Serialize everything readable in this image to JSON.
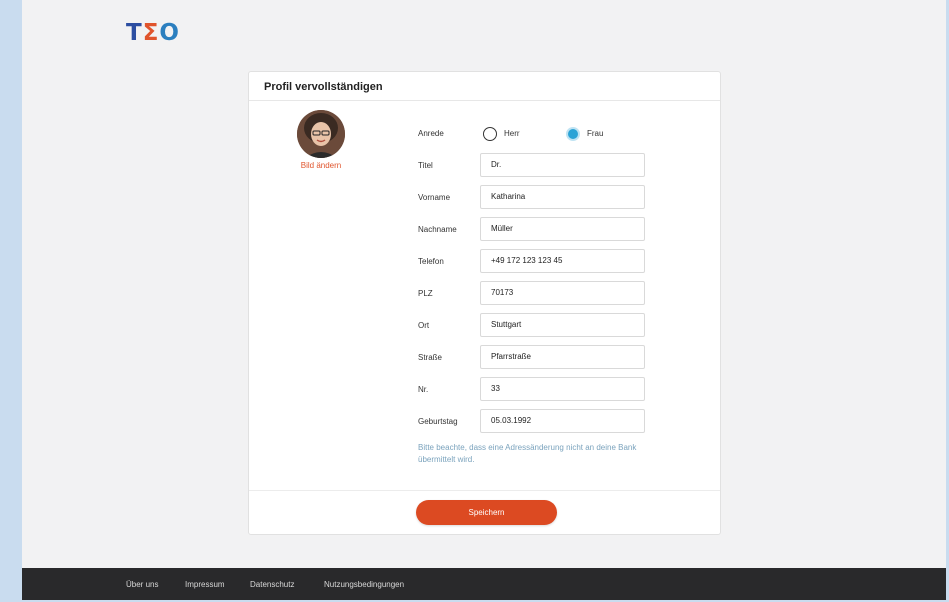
{
  "logo": {
    "part1": "T",
    "part2": "Σ",
    "part3": "O"
  },
  "card": {
    "title": "Profil vervollständigen"
  },
  "profile": {
    "change_photo": "Bild ändern"
  },
  "form": {
    "salutation": {
      "label": "Anrede",
      "options": [
        "Herr",
        "Frau"
      ],
      "selected": "Frau"
    },
    "title": {
      "label": "Titel",
      "value": "Dr."
    },
    "first_name": {
      "label": "Vorname",
      "value": "Katharina"
    },
    "last_name": {
      "label": "Nachname",
      "value": "Müller"
    },
    "phone": {
      "label": "Telefon",
      "value": "+49 172 123 123 45"
    },
    "zip": {
      "label": "PLZ",
      "value": "70173"
    },
    "city": {
      "label": "Ort",
      "value": "Stuttgart"
    },
    "street": {
      "label": "Straße",
      "value": "Pfarrstraße"
    },
    "number": {
      "label": "Nr.",
      "value": "33"
    },
    "birthday": {
      "label": "Geburtstag",
      "value": "05.03.1992"
    },
    "note": "Bitte beachte, dass eine Adressänderung nicht an deine Bank übermittelt wird.",
    "save_label": "Speichern"
  },
  "footer": {
    "links": [
      "Über uns",
      "Impressum",
      "Datenschutz",
      "Nutzungsbedingungen"
    ]
  },
  "colors": {
    "accent": "#dc4a22",
    "radio_selected": "#2ba3d6",
    "footer_bg": "#29292b"
  }
}
